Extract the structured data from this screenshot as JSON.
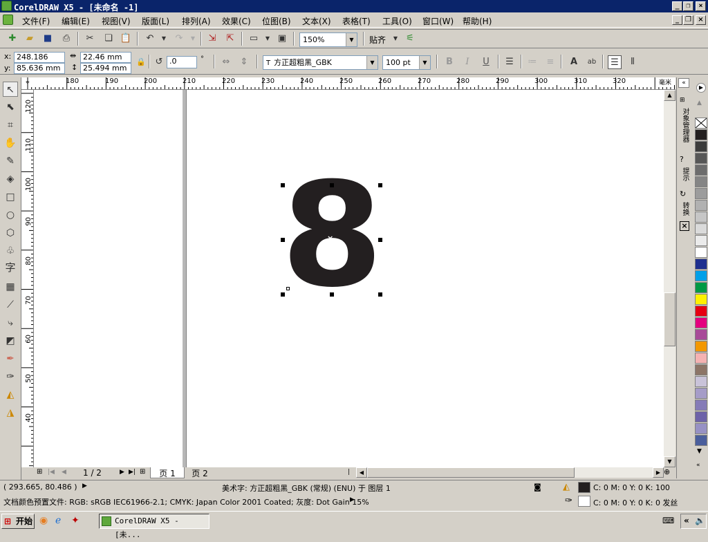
{
  "window": {
    "title": "CorelDRAW X5 - [未命名 -1]"
  },
  "menu": {
    "items": [
      "文件(F)",
      "编辑(E)",
      "视图(V)",
      "版面(L)",
      "排列(A)",
      "效果(C)",
      "位图(B)",
      "文本(X)",
      "表格(T)",
      "工具(O)",
      "窗口(W)",
      "帮助(H)"
    ]
  },
  "toolbar": {
    "zoom": "150%",
    "snap_label": "贴齐"
  },
  "propertybar": {
    "x_label": "x:",
    "x_value": "248.186 mm",
    "y_label": "y:",
    "y_value": "85.636 mm",
    "width_value": "22.46 mm",
    "height_value": "25.494 mm",
    "angle_value": ".0",
    "degree_symbol": "°",
    "font_name": "方正超粗黑_GBK",
    "font_size": "100 pt",
    "bold_label": "B",
    "italic_label": "I",
    "underline_label": "U"
  },
  "ruler": {
    "h_ticks": [
      "180",
      "190",
      "200",
      "210",
      "220",
      "230",
      "240",
      "250",
      "260",
      "270",
      "280",
      "290",
      "300",
      "310",
      "320"
    ],
    "h_unit": "毫米",
    "v_ticks": [
      "120",
      "110",
      "100",
      "90",
      "80",
      "70",
      "60",
      "50",
      "40"
    ]
  },
  "canvas": {
    "text_object": "8"
  },
  "pages": {
    "indicator": "1 / 2",
    "tab1": "页 1",
    "tab2": "页 2"
  },
  "dockers": {
    "object_manager": "对象管理器",
    "hints": "提示",
    "transform": "转换"
  },
  "palette": {
    "colors": [
      "#ffffff",
      "#231f20",
      "#3c3c3c",
      "#575757",
      "#6d6d6d",
      "#858585",
      "#9c9c9c",
      "#b1b1b1",
      "#c6c6c6",
      "#dadada",
      "#ebebeb",
      "#ffffff",
      "#1e2f8f",
      "#00a0e9",
      "#009944",
      "#fff100",
      "#e60012",
      "#e4007f",
      "#a84a98",
      "#f39800",
      "#f5b2b2",
      "#8c7567",
      "#c9c3d9",
      "#a59cc8",
      "#857bb7",
      "#6d62a8",
      "#9791c4",
      "#4a5e9c"
    ]
  },
  "status": {
    "coords": "( 293.665, 80.486 )",
    "object_info": "美术字: 方正超粗黑_GBK (常规) (ENU) 于 图层 1",
    "fill_info": "C: 0 M: 0 Y: 0 K: 100",
    "outline_info": "C: 0 M: 0 Y: 0 K: 0 发丝",
    "color_profile": "文档颜色预置文件: RGB: sRGB IEC61966-2.1; CMYK: Japan Color 2001 Coated; 灰度: Dot Gain 15%"
  },
  "taskbar": {
    "start_label": "开始",
    "task_label": "CorelDRAW X5 - [未..."
  }
}
